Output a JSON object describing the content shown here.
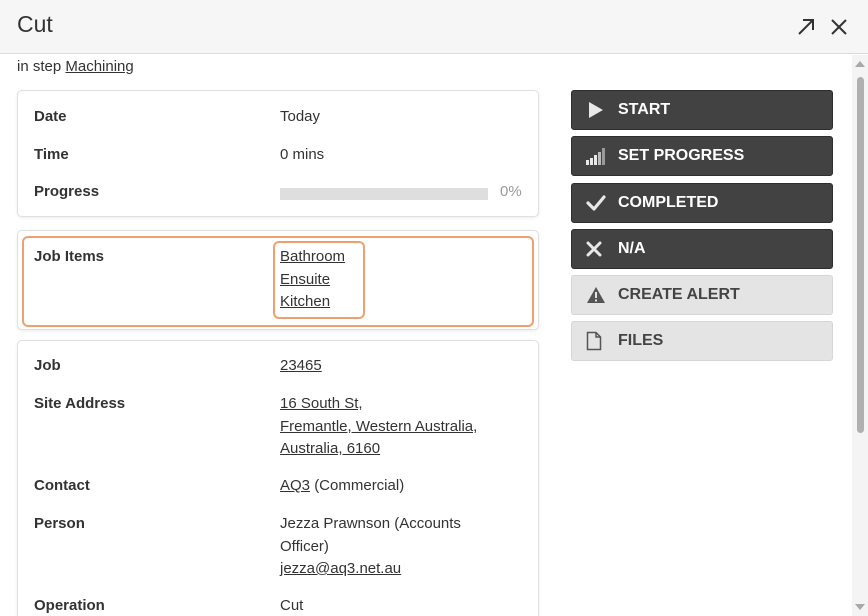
{
  "header": {
    "title": "Cut",
    "expand_icon": "arrow-up-right-icon",
    "close_icon": "close-icon"
  },
  "step": {
    "prefix": "in step",
    "name": "Machining"
  },
  "schedule": {
    "date_label": "Date",
    "date_value": "Today",
    "time_label": "Time",
    "time_value": "0 mins",
    "progress_label": "Progress",
    "progress_fraction": 0,
    "progress_text": "0%"
  },
  "job_items": {
    "label": "Job Items",
    "items": [
      "Bathroom",
      "Ensuite",
      "Kitchen"
    ]
  },
  "details": {
    "job_label": "Job",
    "job_value": "23465",
    "site_label": "Site Address",
    "site_lines": [
      "16 South St,",
      "Fremantle, Western Australia,",
      "Australia, 6160"
    ],
    "contact_label": "Contact",
    "contact_link": "AQ3",
    "contact_suffix": "(Commercial)",
    "person_label": "Person",
    "person_lines": [
      "Jezza Prawnson (Accounts",
      "Officer)"
    ],
    "person_email": "jezza@aq3.net.au",
    "operation_label": "Operation",
    "operation_value": "Cut"
  },
  "actions": {
    "start": "START",
    "set_progress": "SET PROGRESS",
    "completed": "COMPLETED",
    "na": "N/A",
    "create_alert": "CREATE ALERT",
    "files": "FILES"
  },
  "colors": {
    "dark_button": "#424242",
    "light_button": "#e4e4e4",
    "highlight": "#f0a070"
  }
}
